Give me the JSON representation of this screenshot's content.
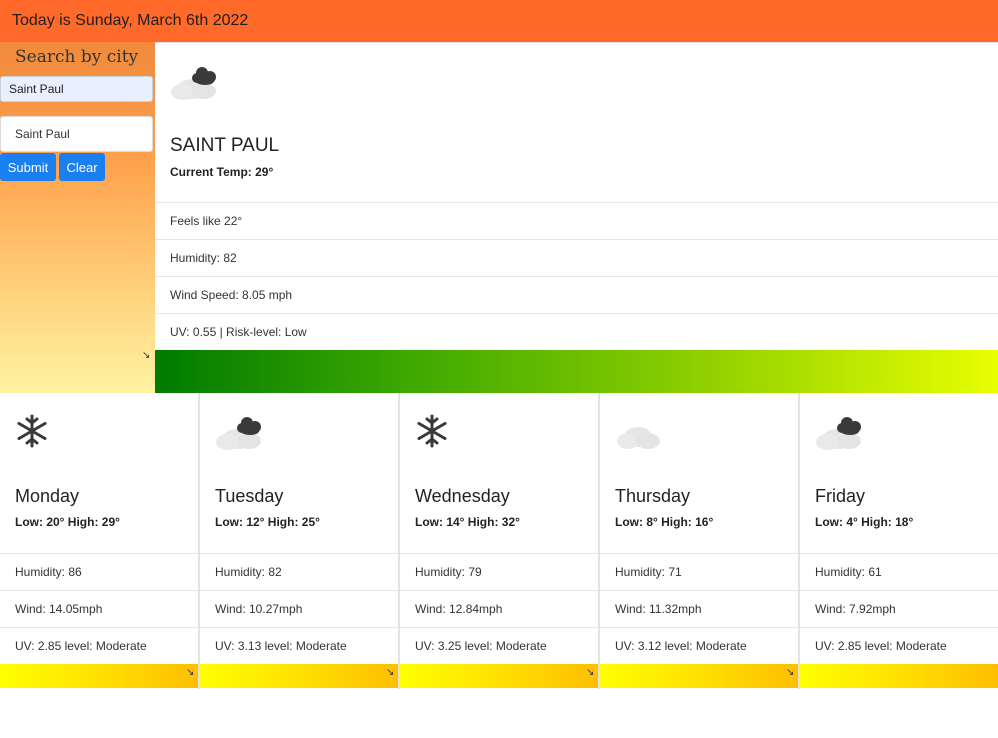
{
  "header": {
    "date_text": "Today is Sunday, March 6th 2022"
  },
  "sidebar": {
    "title": "Search by city",
    "search_value": "Saint Paul",
    "history": [
      "Saint Paul"
    ],
    "submit_label": "Submit",
    "clear_label": "Clear"
  },
  "current": {
    "icon": "partly-cloudy-icon",
    "city": "SAINT PAUL",
    "temp": "Current Temp: 29°",
    "feels_like": "Feels like 22°",
    "humidity": "Humidity: 82",
    "wind": "Wind Speed: 8.05 mph",
    "uv": "UV: 0.55 | Risk-level: Low",
    "uv_colors": [
      "#007a00",
      "#e8ff00"
    ]
  },
  "forecast": [
    {
      "icon": "snowflake-icon",
      "day": "Monday",
      "low_high": "Low: 20° High: 29°",
      "humidity": "Humidity: 86",
      "wind": "Wind: 14.05mph",
      "uv": "UV: 2.85 level: Moderate"
    },
    {
      "icon": "partly-cloudy-icon",
      "day": "Tuesday",
      "low_high": "Low: 12° High: 25°",
      "humidity": "Humidity: 82",
      "wind": "Wind: 10.27mph",
      "uv": "UV: 3.13 level: Moderate"
    },
    {
      "icon": "snowflake-icon",
      "day": "Wednesday",
      "low_high": "Low: 14° High: 32°",
      "humidity": "Humidity: 79",
      "wind": "Wind: 12.84mph",
      "uv": "UV: 3.25 level: Moderate"
    },
    {
      "icon": "cloud-icon",
      "day": "Thursday",
      "low_high": "Low: 8° High: 16°",
      "humidity": "Humidity: 71",
      "wind": "Wind: 11.32mph",
      "uv": "UV: 3.12 level: Moderate"
    },
    {
      "icon": "partly-cloudy-icon",
      "day": "Friday",
      "low_high": "Low: 4° High: 18°",
      "humidity": "Humidity: 61",
      "wind": "Wind: 7.92mph",
      "uv": "UV: 2.85 level: Moderate"
    }
  ],
  "colors": {
    "header": "#ff6a2b",
    "button": "#1a7ff0"
  }
}
